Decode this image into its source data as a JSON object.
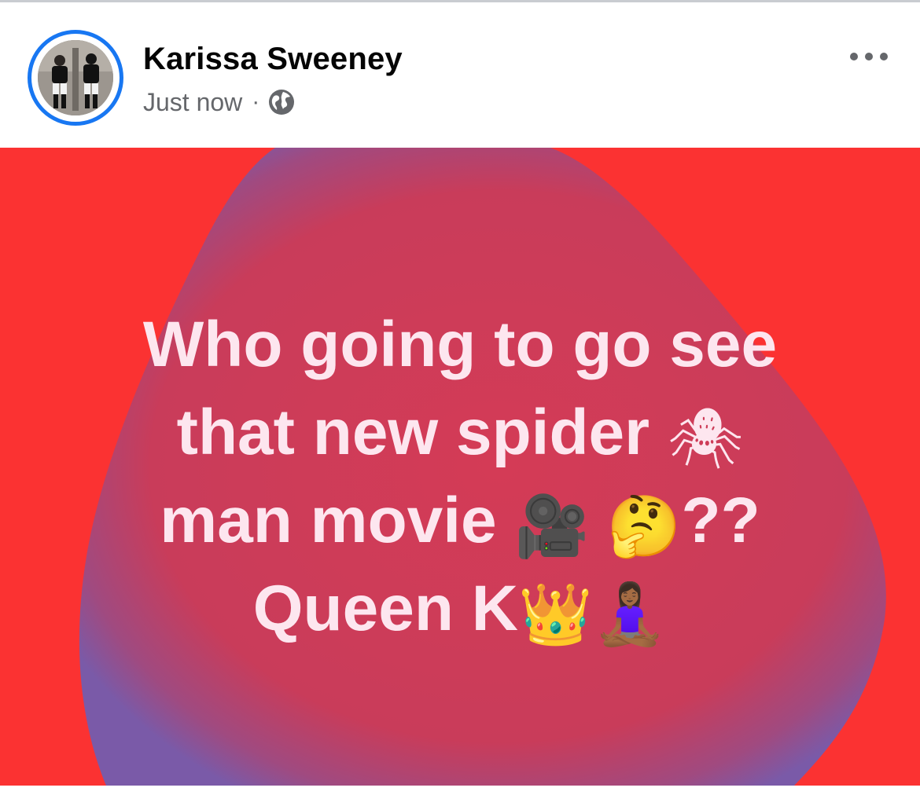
{
  "post": {
    "author_name": "Karissa Sweeney",
    "timestamp": "Just now",
    "separator": "·",
    "audience_icon": "globe-icon",
    "more_icon": "more-horizontal-icon",
    "text_lines": [
      {
        "text": "Who going to go see",
        "emojis": []
      },
      {
        "text": "that new spider ",
        "emojis": [
          "🕷"
        ]
      },
      {
        "text": "man movie ",
        "emojis": [
          "🎥",
          "🤔"
        ],
        "suffix": "??"
      },
      {
        "text": "Queen K",
        "emojis": [
          "👑",
          "🧘🏾‍♀️"
        ]
      }
    ]
  },
  "colors": {
    "background_red": "#fb3232",
    "blob_center": "#d33a57",
    "blob_edge": "#7a5aa8",
    "text": "#fde6ef",
    "avatar_ring": "#1877f2"
  }
}
